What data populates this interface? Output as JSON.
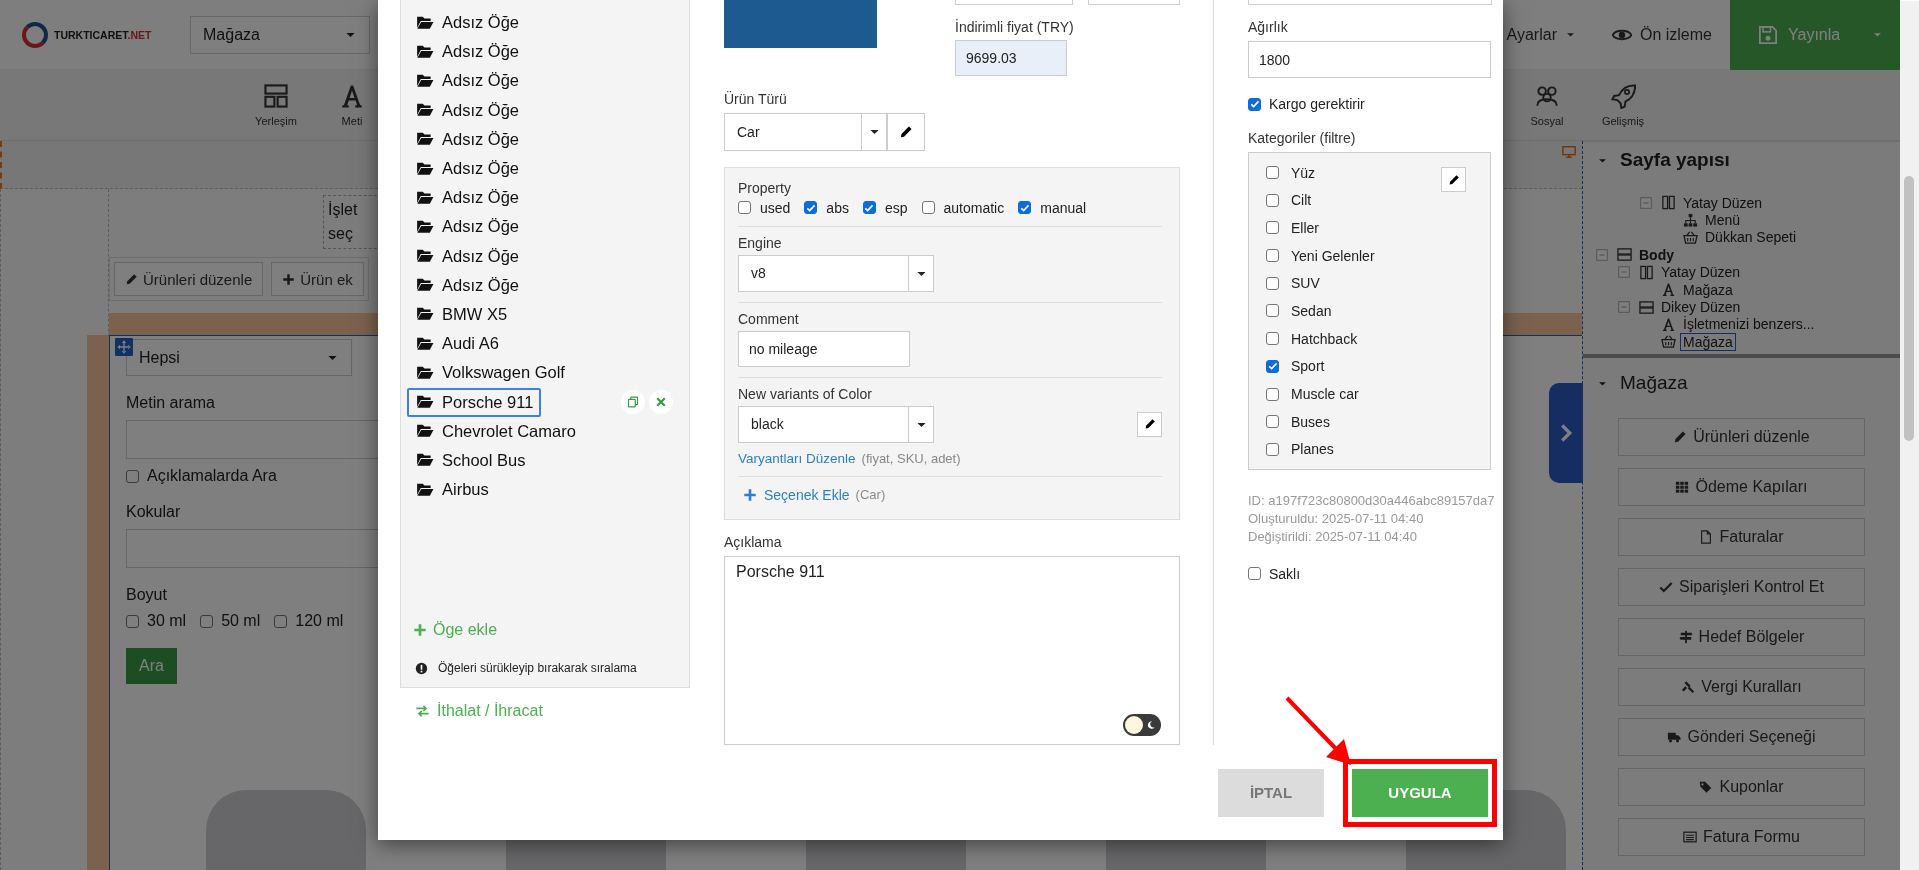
{
  "app_bar": {
    "logo": {
      "main": "TURKTICARET",
      "accent": ".NET"
    },
    "page_select": "Mağaza",
    "menu": {
      "label": "Ayarlar"
    },
    "preview": {
      "label": "Ön izleme"
    },
    "publish": {
      "label": "Yayınla"
    }
  },
  "toolbar": {
    "left": [
      {
        "label": "Yerleşim",
        "kind": "layout"
      },
      {
        "label": "Meti",
        "kind": "text"
      }
    ],
    "right": [
      {
        "label": "Sosyal",
        "kind": "social"
      },
      {
        "label": "Gelişmiş",
        "kind": "rocket"
      }
    ]
  },
  "canvas": {
    "heading_lines": [
      "İşlet",
      "seç"
    ],
    "product_actions": [
      {
        "label": "Ürünleri düzenle",
        "kind": "pencil"
      },
      {
        "label": "Ürün ek",
        "kind": "plus"
      }
    ],
    "filter": {
      "category": "Hepsi",
      "search_label": "Metin arama",
      "search_in_desc": {
        "label": "Açıklamalarda Ara",
        "checked": false
      },
      "scents_label": "Kokular",
      "size": {
        "label": "Boyut",
        "options": [
          {
            "label": "30 ml",
            "checked": false
          },
          {
            "label": "50 ml",
            "checked": false
          },
          {
            "label": "120 ml",
            "checked": false
          }
        ]
      },
      "submit": "Ara"
    }
  },
  "structure_panel": {
    "title": "Sayfa yapısı",
    "expanded": true,
    "continued": [
      {
        "label": "Yatay Düzen",
        "kind": "columns",
        "expanded": true,
        "selected": false,
        "children": [
          {
            "label": "Menü",
            "kind": "sitemap",
            "selected": false
          },
          {
            "label": "Dükkan Sepeti",
            "kind": "basket",
            "selected": false
          }
        ]
      }
    ],
    "tree": [
      {
        "label": "Body",
        "kind": "root",
        "expanded": true,
        "selected": false,
        "children": [
          {
            "label": "Yatay Düzen",
            "kind": "columns",
            "expanded": true,
            "selected": false,
            "children": [
              {
                "label": "Mağaza",
                "kind": "text",
                "selected": false
              }
            ]
          },
          {
            "label": "Dikey Düzen",
            "kind": "rows",
            "expanded": true,
            "selected": false,
            "children": [
              {
                "label": "İşletmenizi benzers...",
                "kind": "text",
                "selected": false
              },
              {
                "label": "Mağaza",
                "kind": "basket",
                "selected": true
              }
            ]
          }
        ]
      }
    ]
  },
  "shop_panel": {
    "title": "Mağaza",
    "expanded": true,
    "buttons": [
      {
        "label": "Ürünleri düzenle",
        "kind": "pencil"
      },
      {
        "label": "Ödeme Kapıları",
        "kind": "grid"
      },
      {
        "label": "Faturalar",
        "kind": "file"
      },
      {
        "label": "Siparişleri Kontrol Et",
        "kind": "check"
      },
      {
        "label": "Hedef Bölgeler",
        "kind": "signpost"
      },
      {
        "label": "Vergi Kuralları",
        "kind": "gavel"
      },
      {
        "label": "Gönderi Seçeneği",
        "kind": "truck"
      },
      {
        "label": "Kuponlar",
        "kind": "tags"
      },
      {
        "label": "Fatura Formu",
        "kind": "form"
      }
    ]
  },
  "modal": {
    "items": [
      {
        "label": "Adsız Öğe",
        "selected": false
      },
      {
        "label": "Adsız Öğe",
        "selected": false
      },
      {
        "label": "Adsız Öğe",
        "selected": false
      },
      {
        "label": "Adsız Öğe",
        "selected": false
      },
      {
        "label": "Adsız Öğe",
        "selected": false
      },
      {
        "label": "Adsız Öğe",
        "selected": false
      },
      {
        "label": "Adsız Öğe",
        "selected": false
      },
      {
        "label": "Adsız Öğe",
        "selected": false
      },
      {
        "label": "Adsız Öğe",
        "selected": false
      },
      {
        "label": "Adsız Öğe",
        "selected": false
      },
      {
        "label": "BMW X5",
        "selected": false
      },
      {
        "label": "Audi A6",
        "selected": false
      },
      {
        "label": "Volkswagen Golf",
        "selected": false
      },
      {
        "label": "Porsche 911",
        "selected": true
      },
      {
        "label": "Chevrolet Camaro",
        "selected": false
      },
      {
        "label": "School Bus",
        "selected": false
      },
      {
        "label": "Airbus",
        "selected": false
      }
    ],
    "add_item": "Öge ekle",
    "hint": "Öğeleri sürükleyip bırakarak sıralama",
    "import_export": "İthalat / İhracat",
    "discount_price": {
      "label": "İndirimli fiyat (TRY)",
      "value": "9699.03"
    },
    "product_type": {
      "label": "Ürün Türü",
      "value": "Car"
    },
    "attributes": [
      {
        "kind": "checkboxes",
        "label": "Property",
        "options": [
          {
            "label": "used",
            "checked": false
          },
          {
            "label": "abs",
            "checked": true
          },
          {
            "label": "esp",
            "checked": true
          },
          {
            "label": "automatic",
            "checked": false
          },
          {
            "label": "manual",
            "checked": true
          }
        ]
      },
      {
        "kind": "select",
        "label": "Engine",
        "value": "v8"
      },
      {
        "kind": "text",
        "label": "Comment",
        "value": "no mileage"
      },
      {
        "kind": "variants",
        "label": "New variants of Color",
        "value": "black",
        "link": "Varyantları Düzenle",
        "hint": "(fiyat, SKU, adet)"
      }
    ],
    "add_option": {
      "label": "Seçenek Ekle",
      "hint": "(Car)"
    },
    "description": {
      "label": "Açıklama",
      "value": "Porsche 911",
      "dark_mode": false
    },
    "weight": {
      "label": "Ağırlık",
      "value": "1800"
    },
    "requires_shipping": {
      "label": "Kargo gerektirir",
      "checked": true
    },
    "categories": {
      "label": "Kategoriler (filtre)",
      "items": [
        {
          "label": "Yüz",
          "checked": false
        },
        {
          "label": "Cilt",
          "checked": false
        },
        {
          "label": "Eller",
          "checked": false
        },
        {
          "label": "Yeni Gelenler",
          "checked": false
        },
        {
          "label": "SUV",
          "checked": false
        },
        {
          "label": "Sedan",
          "checked": false
        },
        {
          "label": "Hatchback",
          "checked": false
        },
        {
          "label": "Sport",
          "checked": true
        },
        {
          "label": "Muscle car",
          "checked": false
        },
        {
          "label": "Buses",
          "checked": false
        },
        {
          "label": "Planes",
          "checked": false
        }
      ]
    },
    "meta": [
      "ID: a197f723c80800d30a446abc89157da7",
      "Oluşturuldu: 2025-07-11 04:40",
      "Değiştirildi: 2025-07-11 04:40"
    ],
    "hidden": {
      "label": "Saklı",
      "checked": false
    },
    "buttons": [
      {
        "label": "İPTAL",
        "kind": "cancel",
        "highlighted": false
      },
      {
        "label": "UYGULA",
        "kind": "apply",
        "highlighted": true
      }
    ]
  }
}
